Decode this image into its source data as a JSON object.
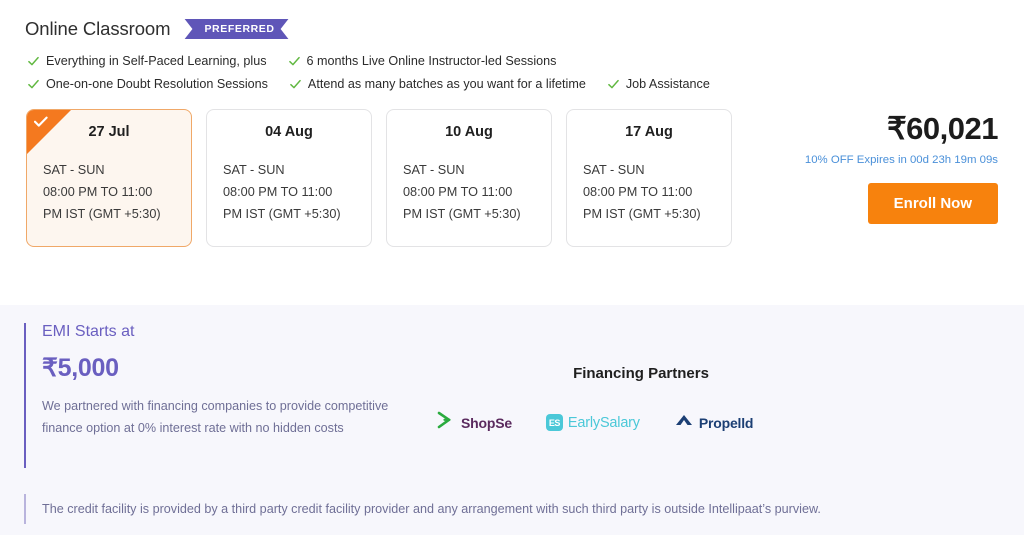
{
  "header": {
    "title": "Online Classroom",
    "badge_label": "PREFERRED"
  },
  "features": [
    {
      "label": "Everything in Self-Paced Learning, plus",
      "icon": "check-icon"
    },
    {
      "label": "6 months Live Online Instructor-led Sessions",
      "icon": "check-icon"
    },
    {
      "label": "One-on-one Doubt Resolution Sessions",
      "icon": "check-icon"
    },
    {
      "label": "Attend as many batches as you want for a lifetime",
      "icon": "check-icon"
    },
    {
      "label": "Job Assistance",
      "icon": "check-icon"
    }
  ],
  "batches": [
    {
      "date": "27 Jul",
      "days": "SAT - SUN",
      "time_line1": "08:00 PM TO 11:00",
      "time_line2": "PM IST (GMT +5:30)",
      "selected": true,
      "selected_icon": "check-icon"
    },
    {
      "date": "04 Aug",
      "days": "SAT - SUN",
      "time_line1": "08:00 PM TO 11:00",
      "time_line2": "PM IST (GMT +5:30)",
      "selected": false
    },
    {
      "date": "10 Aug",
      "days": "SAT - SUN",
      "time_line1": "08:00 PM TO 11:00",
      "time_line2": "PM IST (GMT +5:30)",
      "selected": false
    },
    {
      "date": "17 Aug",
      "days": "SAT - SUN",
      "time_line1": "08:00 PM TO 11:00",
      "time_line2": "PM IST (GMT +5:30)",
      "selected": false
    }
  ],
  "pricing": {
    "price": "₹60,021",
    "offer_text": "10% OFF Expires in 00d 23h 19m 09s",
    "enroll_label": "Enroll Now"
  },
  "emi": {
    "title": "EMI Starts at",
    "amount": "₹5,000",
    "description": "We partnered with financing companies to provide competitive finance option at 0% interest rate with no hidden costs"
  },
  "financing": {
    "title": "Financing Partners",
    "partners": [
      {
        "name": "ShopSe",
        "icon": "shopse-chevron-icon"
      },
      {
        "name": "EarlySalary",
        "icon": "earlysalary-es-icon",
        "icon_text": "ES"
      },
      {
        "name": "Propelld",
        "icon": "propelld-triangle-icon"
      }
    ]
  },
  "disclaimer": {
    "text": "The credit facility is provided by a third party credit facility provider and any arrangement with such third party is outside Intellipaat’s purview."
  },
  "colors": {
    "badge_purple": "#5f56b8",
    "accent_orange": "#f7820d",
    "selected_border": "#f0a868",
    "selected_bg": "#fdf6ef",
    "check_green": "#61b841",
    "offer_blue": "#4a90d9",
    "emi_purple": "#6a5fc0",
    "panel_bg": "#f7f7fc",
    "shopse_green": "#2bab3f",
    "shopse_text": "#5a2a5e",
    "earlysalary_cyan": "#4bc8d8",
    "propelld_navy": "#1c3f74"
  }
}
